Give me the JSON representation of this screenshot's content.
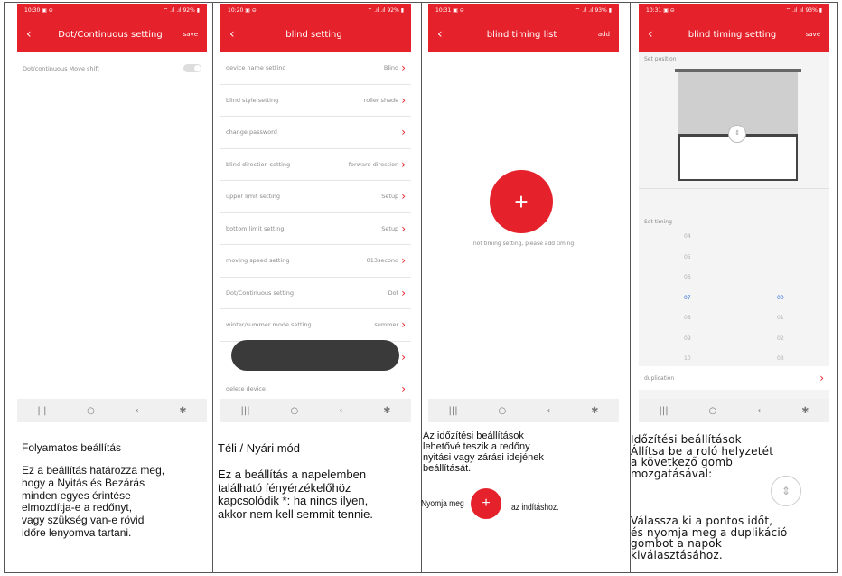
{
  "colors": {
    "brand_red": "#e5222b"
  },
  "panels": [
    {
      "status_left": "10:30 ▣ ⊝",
      "status_right": "⌔ .ıl .ıl 92% ▮",
      "title": "Dot/Continuous setting",
      "action": "save",
      "toggle_label": "Dot/continuous Move shift"
    },
    {
      "status_left": "10:20 ▣ ⊝",
      "status_right": "⌔ .ıl .ıl 92% ▮",
      "title": "blind setting",
      "rows": [
        {
          "label": "device name setting",
          "value": "Blind"
        },
        {
          "label": "blind style setting",
          "value": "roller shade"
        },
        {
          "label": "change password",
          "value": ""
        },
        {
          "label": "blind direction setting",
          "value": "forward direction"
        },
        {
          "label": "upper limit setting",
          "value": "Setup"
        },
        {
          "label": "bottom limit setting",
          "value": "Setup"
        },
        {
          "label": "moving speed setting",
          "value": "013second"
        },
        {
          "label": "Dot/Continuous setting",
          "value": "Dot"
        },
        {
          "label": "winter/summer mode setting",
          "value": "summer"
        },
        {
          "label": "",
          "value": ""
        },
        {
          "label": "delete device",
          "value": ""
        }
      ]
    },
    {
      "status_left": "10:31 ▣ ⊝",
      "status_right": "⌔ .ıl .ıl 93% ▮",
      "title": "blind timing list",
      "action": "add",
      "empty_text": "not timing setting, please add timing"
    },
    {
      "status_left": "10:31 ▣ ⊝",
      "status_right": "⌔ .ıl .ıl 93% ▮",
      "title": "blind timing setting",
      "action": "save",
      "set_position": "Set position",
      "set_timing": "Set timing",
      "hours": [
        "04",
        "05",
        "06",
        "07",
        "08",
        "09",
        "10"
      ],
      "minutes": [
        "",
        "",
        "",
        "00",
        "01",
        "02",
        "03"
      ],
      "duplication": "duplication"
    }
  ],
  "nav_icons": {
    "recent": "|||",
    "home": "○",
    "back": "‹",
    "accessibility": "✱"
  },
  "captions": {
    "c1_title": "Folyamatos beállítás",
    "c1_body": [
      "Ez a beállítás határozza meg,",
      "hogy a Nyitás és Bezárás",
      "minden egyes érintése",
      "elmozdítja-e a redőnyt,",
      "vagy szükség  van-e rövid",
      "időre lenyomva tartani."
    ],
    "c2_title": "Téli / Nyári mód",
    "c2_body": [
      "Ez a beállítás a napelemben",
      "található fényérzékelőhöz",
      "kapcsolódik *: ha nincs ilyen,",
      " akkor nem kell semmit tennie."
    ],
    "c3_body": [
      "Az időzítési beállítások",
      "lehetővé teszik a redőny",
      "nyitási vagy zárási idejének",
      "beállítását."
    ],
    "c3_press": "Nyomja meg",
    "c3_start": "az indításhoz.",
    "c4_body": [
      "Időzítési beállítások",
      "Állítsa be a roló helyzetét",
      "a következő gomb",
      "mozgatásával:"
    ],
    "c4_body2": [
      "Válassza ki a pontos időt,",
      "és nyomja meg a duplikáció",
      "gombot a napok",
      "kiválasztásához."
    ]
  }
}
